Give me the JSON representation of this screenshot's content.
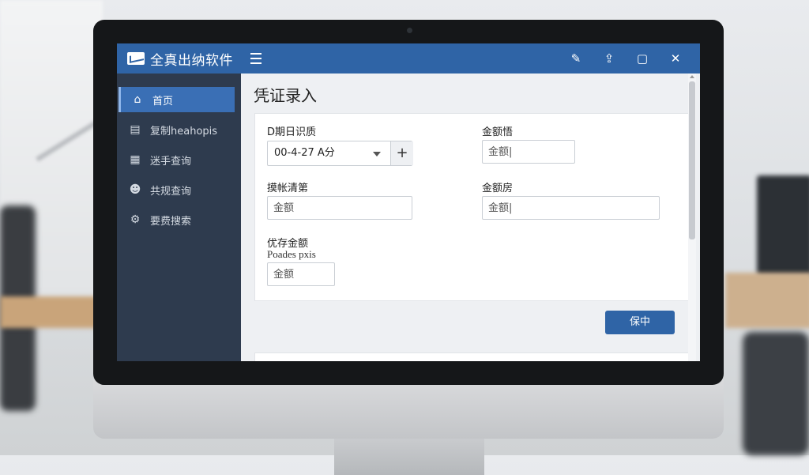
{
  "app": {
    "title": "全真出纳软件",
    "icon": "envelope-logo-icon"
  },
  "topbar": {
    "menu_icon": "hamburger-icon",
    "actions": [
      {
        "name": "edit-icon",
        "glyph": "✎"
      },
      {
        "name": "share-icon",
        "glyph": "⇪"
      },
      {
        "name": "window-icon",
        "glyph": "▢"
      },
      {
        "name": "close-icon",
        "glyph": "✕"
      }
    ]
  },
  "sidebar": {
    "items": [
      {
        "label": "首页",
        "icon": "home-icon",
        "glyph": "⌂",
        "active": true
      },
      {
        "label": "复制heahopis",
        "icon": "document-icon",
        "glyph": "▤",
        "active": false
      },
      {
        "label": "迷手查询",
        "icon": "list-icon",
        "glyph": "▦",
        "active": false
      },
      {
        "label": "共规查询",
        "icon": "users-icon",
        "glyph": "☻",
        "active": false
      },
      {
        "label": "要费搜索",
        "icon": "gear-icon",
        "glyph": "⚙",
        "active": false
      }
    ]
  },
  "main": {
    "page_title": "凭证录入",
    "fields": {
      "date": {
        "label": "D期日识质",
        "value": "00-4-27 A分"
      },
      "amount1": {
        "label": "金额悟",
        "placeholder": "金额|"
      },
      "extra": {
        "label": "摸帐清第",
        "placeholder": "金额"
      },
      "amount2": {
        "label": "金额房",
        "placeholder": "金额|"
      },
      "save_amount": {
        "label": "优存金额",
        "sublabel": "Poades pxis",
        "placeholder": "金额"
      }
    },
    "save_button": "保中"
  },
  "colors": {
    "accent": "#2f64a6",
    "sidebar": "#2e3b4e",
    "active_item": "#3a6fb5"
  }
}
